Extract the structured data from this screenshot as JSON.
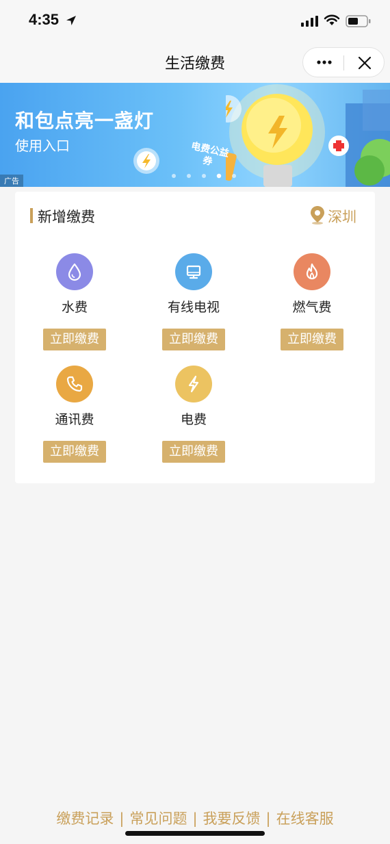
{
  "status_bar": {
    "time": "4:35",
    "icons": [
      "location-arrow-icon",
      "signal-icon",
      "wifi-icon",
      "battery-icon"
    ]
  },
  "nav": {
    "title": "生活缴费",
    "capsule_icons": [
      "more-icon",
      "close-icon"
    ]
  },
  "banner": {
    "title": "和包点亮一盏灯",
    "subtitle": "使用入口",
    "ad_tag": "广告",
    "coupon_text": "电费公益券",
    "background_color": "#5ab4f4"
  },
  "new_payment": {
    "title": "新增缴费",
    "city": "深圳",
    "accent_color": "#c9a05a",
    "items": [
      {
        "label": "水费",
        "button": "立即缴费",
        "icon": "water-drop-icon",
        "color": "#8b8ae6"
      },
      {
        "label": "有线电视",
        "button": "立即缴费",
        "icon": "tv-monitor-icon",
        "color": "#5aabe9"
      },
      {
        "label": "燃气费",
        "button": "立即缴费",
        "icon": "flame-icon",
        "color": "#e98761"
      },
      {
        "label": "通讯费",
        "button": "立即缴费",
        "icon": "phone-icon",
        "color": "#e9a843"
      },
      {
        "label": "电费",
        "button": "立即缴费",
        "icon": "lightning-icon",
        "color": "#ecc361"
      }
    ]
  },
  "footer": {
    "links": [
      "缴费记录",
      "常见问题",
      "我要反馈",
      "在线客服"
    ]
  }
}
